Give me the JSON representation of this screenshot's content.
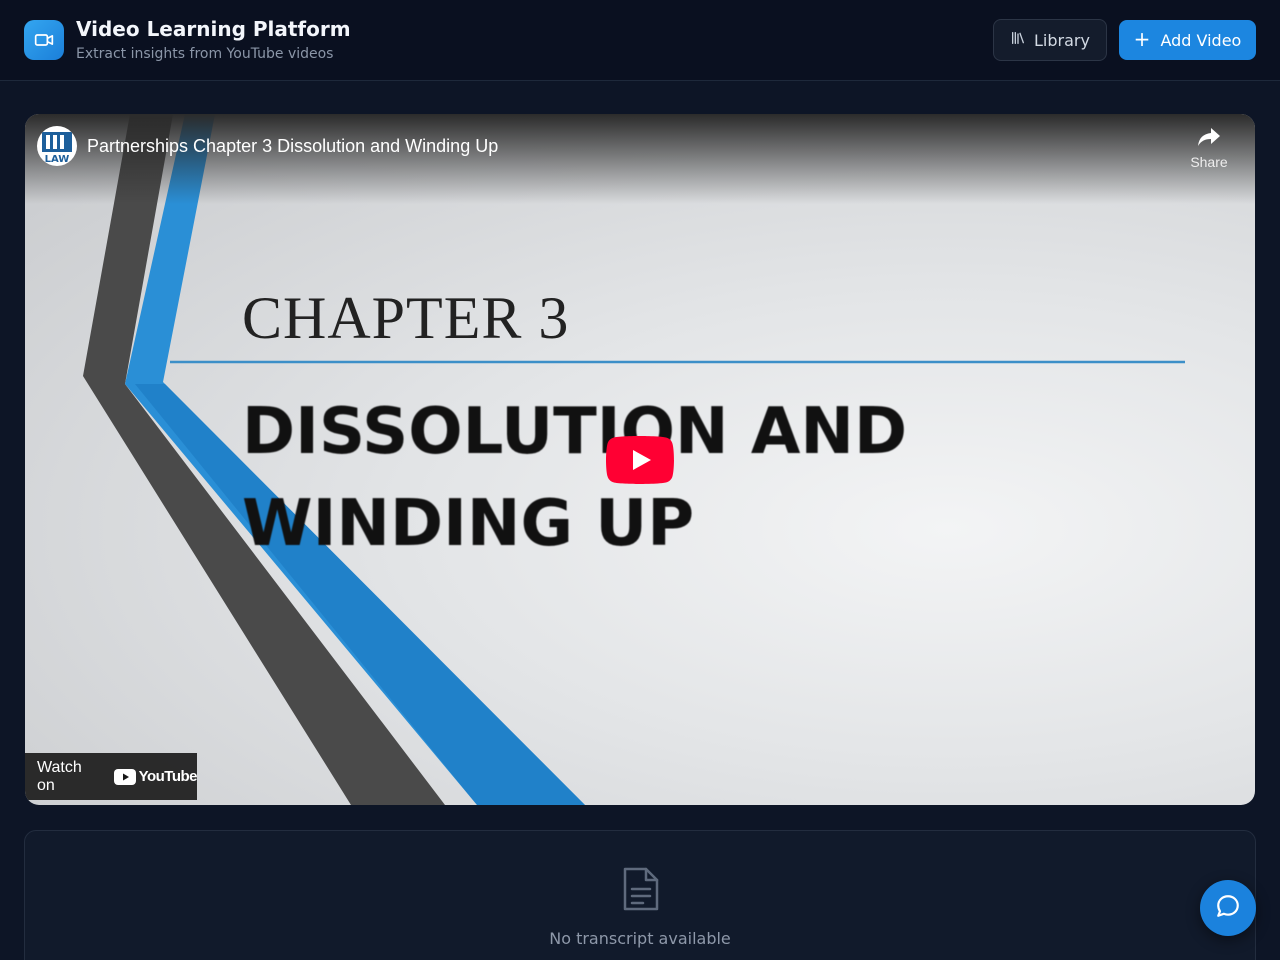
{
  "header": {
    "title": "Video Learning Platform",
    "subtitle": "Extract insights from YouTube videos",
    "logo_icon": "video-camera-icon",
    "library_label": "Library",
    "library_icon": "library-icon",
    "add_video_label": "Add Video",
    "add_video_icon": "plus-icon"
  },
  "video": {
    "title": "Partnerships Chapter 3 Dissolution and Winding Up",
    "channel_avatar_text": "LAW",
    "share_label": "Share",
    "slide_chapter": "CHAPTER 3",
    "slide_title_line1": "DISSOLUTION AND",
    "slide_title_line2": "WINDING UP",
    "watch_on_label": "Watch on",
    "youtube_wordmark": "YouTube"
  },
  "transcript": {
    "empty_label": "No transcript available",
    "icon": "document-icon"
  },
  "chat": {
    "icon": "chat-bubble-icon"
  },
  "colors": {
    "background": "#0d1526",
    "accent": "#1c86e0",
    "youtube_red": "#ff0033"
  }
}
